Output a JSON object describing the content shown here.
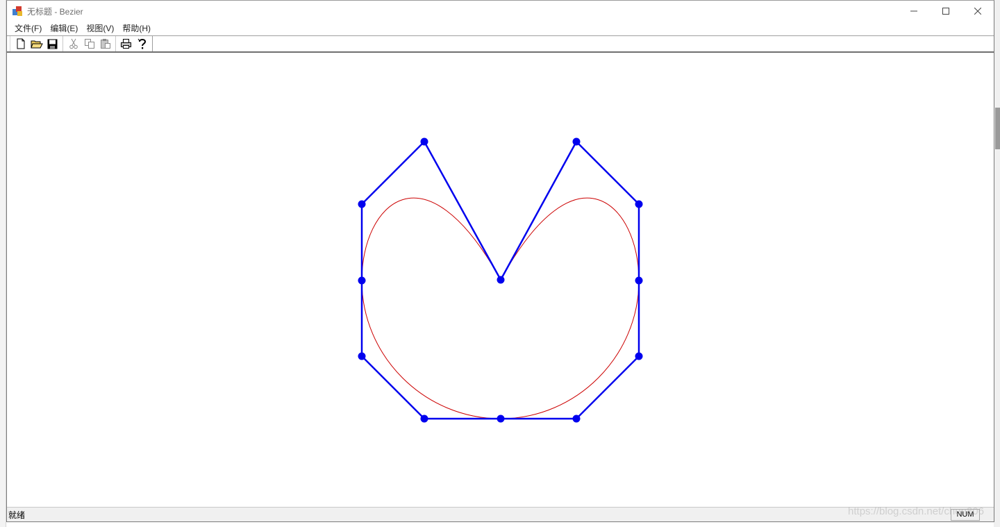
{
  "window": {
    "title": "无标题 - Bezier"
  },
  "menu": {
    "items": [
      "文件(F)",
      "编辑(E)",
      "视图(V)",
      "帮助(H)"
    ]
  },
  "toolbar": {
    "buttons": [
      {
        "icon": "new-file-icon"
      },
      {
        "icon": "open-folder-icon"
      },
      {
        "icon": "save-icon"
      },
      {
        "icon": "cut-icon",
        "enabled": false
      },
      {
        "icon": "copy-icon",
        "enabled": false
      },
      {
        "icon": "paste-icon",
        "enabled": false
      },
      {
        "icon": "print-icon"
      },
      {
        "icon": "help-icon"
      }
    ]
  },
  "status": {
    "text": "就绪",
    "num": "NUM"
  },
  "watermark": "https://blog.csdn.net/chen806",
  "drawing": {
    "polygon_color": "#0000ee",
    "curve_color": "#cc0000"
  }
}
